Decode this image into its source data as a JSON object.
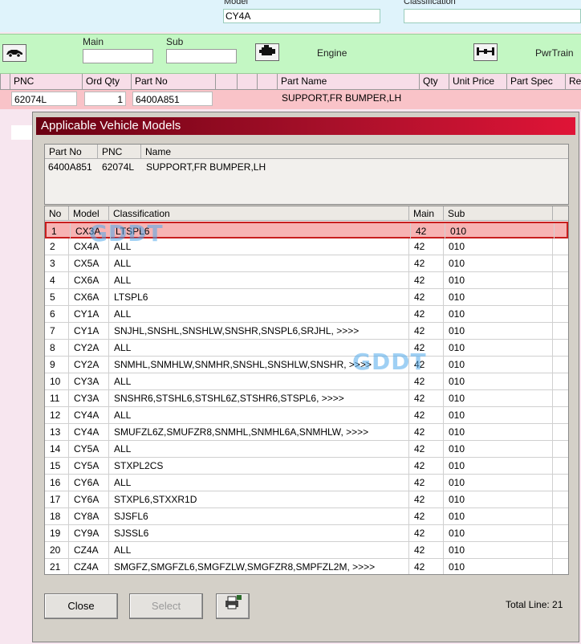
{
  "top": {
    "model_label": "Model",
    "model_value": "CY4A",
    "classification_label": "Classification",
    "classification_value": ""
  },
  "toolbar": {
    "main_label": "Main",
    "sub_label": "Sub",
    "main_value": "",
    "sub_value": "",
    "engine_label": "Engine",
    "pwrtrain_label": "PwrTrain"
  },
  "parts_header": [
    "PNC",
    "Ord Qty",
    "Part No",
    "",
    "",
    "Part Name",
    "Qty",
    "Unit Price",
    "Part Spec",
    "Re"
  ],
  "parts_row": {
    "pnc": "62074L",
    "ord_qty": "1",
    "part_no": "6400A851",
    "part_name": "SUPPORT,FR BUMPER,LH"
  },
  "dialog": {
    "title": "Applicable Vehicle Models",
    "info_headers": [
      "Part No",
      "PNC",
      "Name"
    ],
    "info": {
      "part_no": "6400A851",
      "pnc": "62074L",
      "name": "SUPPORT,FR BUMPER,LH"
    },
    "grid_headers": [
      "No",
      "Model",
      "Classification",
      "Main",
      "Sub"
    ],
    "rows": [
      [
        "1",
        "CX3A",
        "LTSPL6",
        "42",
        "010"
      ],
      [
        "2",
        "CX4A",
        "ALL",
        "42",
        "010"
      ],
      [
        "3",
        "CX5A",
        "ALL",
        "42",
        "010"
      ],
      [
        "4",
        "CX6A",
        "ALL",
        "42",
        "010"
      ],
      [
        "5",
        "CX6A",
        "LTSPL6",
        "42",
        "010"
      ],
      [
        "6",
        "CY1A",
        "ALL",
        "42",
        "010"
      ],
      [
        "7",
        "CY1A",
        "SNJHL,SNSHL,SNSHLW,SNSHR,SNSPL6,SRJHL,  >>>>",
        "42",
        "010"
      ],
      [
        "8",
        "CY2A",
        "ALL",
        "42",
        "010"
      ],
      [
        "9",
        "CY2A",
        "SNMHL,SNMHLW,SNMHR,SNSHL,SNSHLW,SNSHR, >>>>",
        "42",
        "010"
      ],
      [
        "10",
        "CY3A",
        "ALL",
        "42",
        "010"
      ],
      [
        "11",
        "CY3A",
        "SNSHR6,STSHL6,STSHL6Z,STSHR6,STSPL6,  >>>>",
        "42",
        "010"
      ],
      [
        "12",
        "CY4A",
        "ALL",
        "42",
        "010"
      ],
      [
        "13",
        "CY4A",
        "SMUFZL6Z,SMUFZR8,SNMHL,SNMHL6A,SNMHLW,  >>>>",
        "42",
        "010"
      ],
      [
        "14",
        "CY5A",
        "ALL",
        "42",
        "010"
      ],
      [
        "15",
        "CY5A",
        "STXPL2CS",
        "42",
        "010"
      ],
      [
        "16",
        "CY6A",
        "ALL",
        "42",
        "010"
      ],
      [
        "17",
        "CY6A",
        "STXPL6,STXXR1D",
        "42",
        "010"
      ],
      [
        "18",
        "CY8A",
        "SJSFL6",
        "42",
        "010"
      ],
      [
        "19",
        "CY9A",
        "SJSSL6",
        "42",
        "010"
      ],
      [
        "20",
        "CZ4A",
        "ALL",
        "42",
        "010"
      ],
      [
        "21",
        "CZ4A",
        "SMGFZ,SMGFZL6,SMGFZLW,SMGFZR8,SMPFZL2M,  >>>>",
        "42",
        "010"
      ]
    ],
    "selected_index": 0,
    "close_label": "Close",
    "select_label": "Select",
    "total_label": "Total Line: 21",
    "watermark": "GDDT"
  },
  "icons": [
    "car-icon",
    "engine-icon",
    "axle-icon",
    "print-icon"
  ],
  "colors": {
    "green_bar": "#c3f7c3",
    "title_start": "#6a0012",
    "title_end": "#e01437",
    "selected_row": "#f7b3b3",
    "selected_border": "#c81e1e"
  }
}
